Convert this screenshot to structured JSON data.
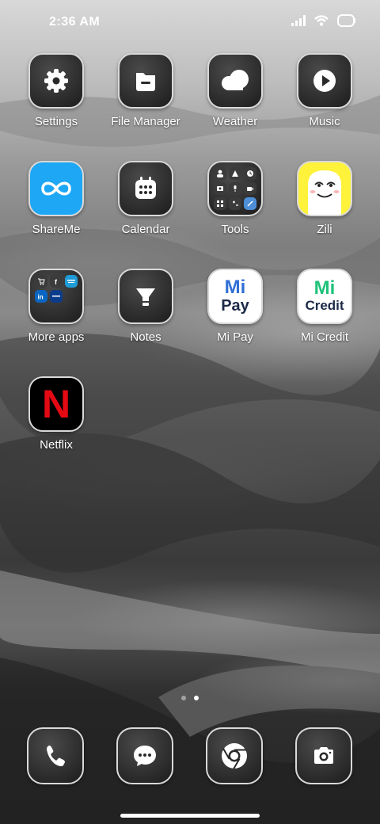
{
  "status_bar": {
    "time": "2:36 AM",
    "icons": [
      "signal-icon",
      "wifi-icon",
      "battery-icon"
    ]
  },
  "apps": [
    {
      "label": "Settings",
      "icon": "gear-icon"
    },
    {
      "label": "File Manager",
      "icon": "folder-icon"
    },
    {
      "label": "Weather",
      "icon": "cloud-icon"
    },
    {
      "label": "Music",
      "icon": "play-icon"
    },
    {
      "label": "ShareMe",
      "icon": "infinity-icon",
      "color": "#1ea7f5"
    },
    {
      "label": "Calendar",
      "icon": "calendar-icon"
    },
    {
      "label": "Tools",
      "icon": "tools-folder-icon"
    },
    {
      "label": "Zili",
      "icon": "zili-face-icon",
      "color": "#fff23a"
    },
    {
      "label": "More apps",
      "icon": "more-apps-folder-icon"
    },
    {
      "label": "Notes",
      "icon": "notes-icon"
    },
    {
      "label": "Mi Pay",
      "icon": "mi-pay-logo",
      "logo_top": "Mi",
      "logo_bottom": "Pay",
      "color": "#2f6fd6"
    },
    {
      "label": "Mi Credit",
      "icon": "mi-credit-logo",
      "logo_top": "Mi",
      "logo_bottom": "Credit",
      "color": "#1fc27a"
    },
    {
      "label": "Netflix",
      "icon": "netflix-logo",
      "logo": "N",
      "color": "#e50914"
    }
  ],
  "page_dots": {
    "count": 2,
    "active": 1
  },
  "dock": [
    {
      "name": "phone-icon"
    },
    {
      "name": "messages-icon"
    },
    {
      "name": "chrome-icon"
    },
    {
      "name": "camera-icon"
    }
  ]
}
